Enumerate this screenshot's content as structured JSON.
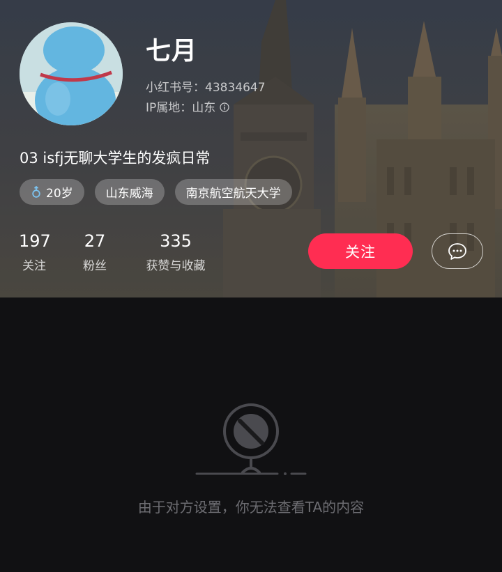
{
  "profile": {
    "nickname": "七月",
    "id_text": "小红书号：43834647",
    "ip_text": "IP属地：山东",
    "bio": "03 isfj无聊大学生的发疯日常",
    "tags": {
      "age": "20岁",
      "location": "山东威海",
      "school": "南京航空航天大学"
    }
  },
  "stats": {
    "following": {
      "value": "197",
      "label": "关注"
    },
    "followers": {
      "value": "27",
      "label": "粉丝"
    },
    "likes": {
      "value": "335",
      "label": "获赞与收藏"
    }
  },
  "actions": {
    "follow_label": "关注"
  },
  "empty_state": {
    "message": "由于对方设置，你无法查看TA的内容"
  },
  "colors": {
    "follow_button": "#ff2d52",
    "background": "#111113",
    "empty_text": "#6d6d72"
  },
  "icons": [
    "male-icon",
    "info-icon",
    "chat-bubble-icon",
    "blocked-illustration-icon"
  ]
}
